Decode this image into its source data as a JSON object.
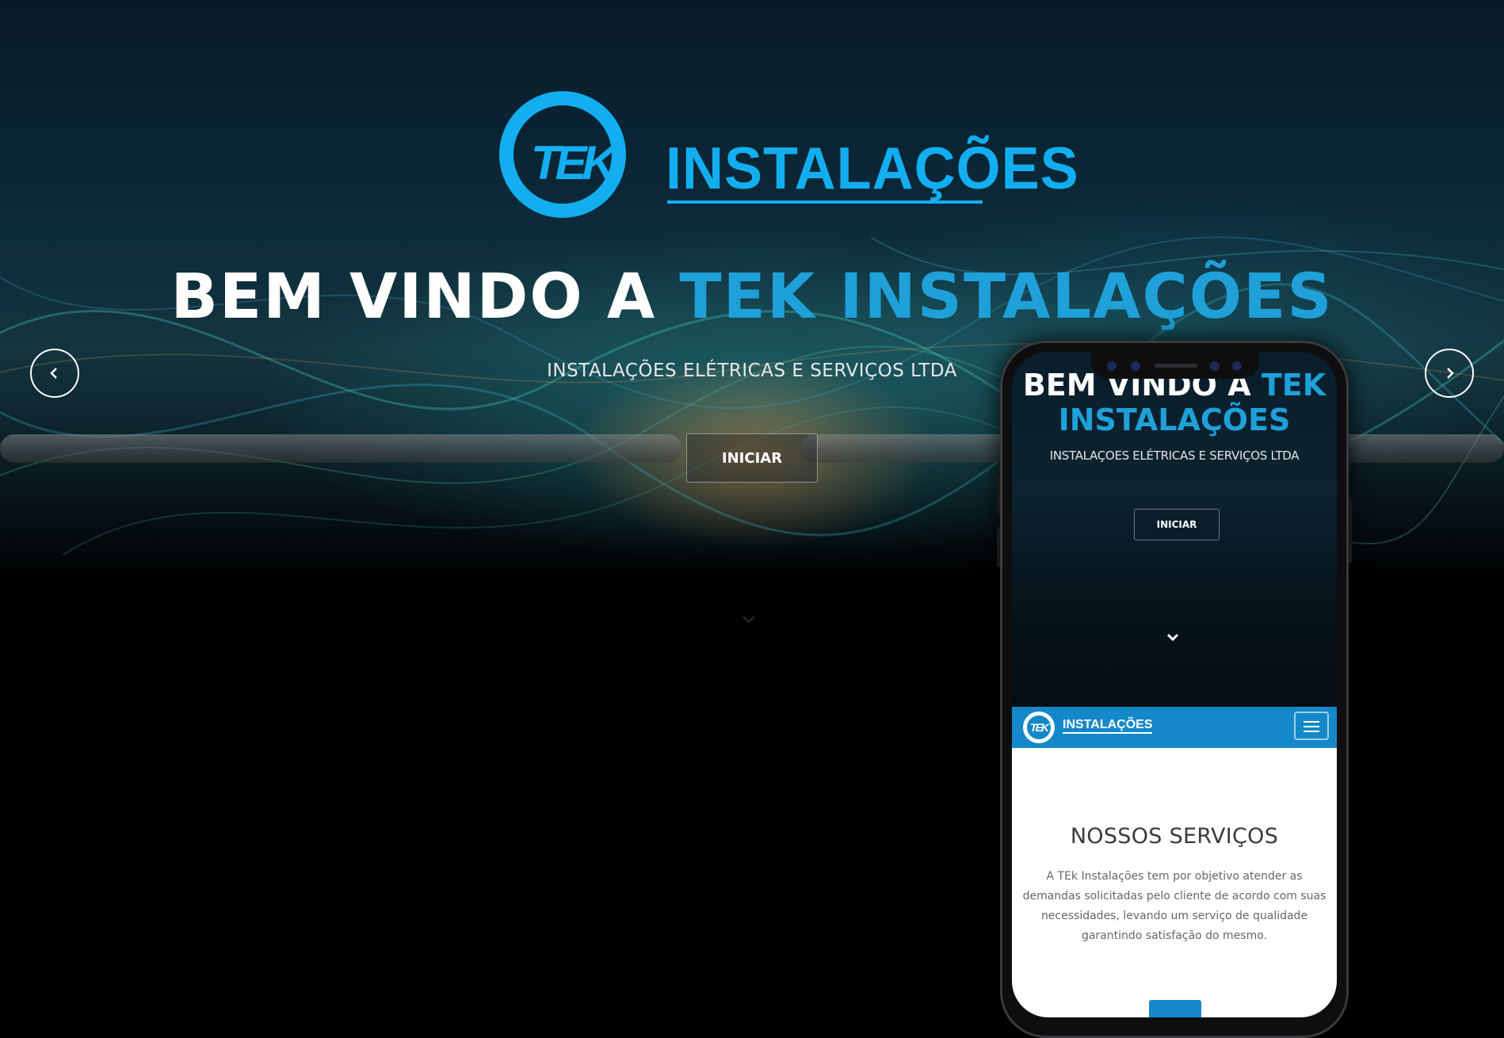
{
  "brand": {
    "logo_mark": "TEK",
    "logo_word": "INSTALAÇÕES",
    "accent_color": "#12aef0"
  },
  "hero": {
    "headline_prefix": "BEM VINDO A",
    "headline_accent": "TEK INSTALAÇÕES",
    "subtitle": "INSTALAÇÕES ELÉTRICAS E SERVIÇOS LTDA",
    "cta_label": "INICIAR",
    "prev_icon": "chevron-left-icon",
    "next_icon": "chevron-right-icon",
    "scroll_icon": "chevron-down-icon"
  },
  "phone": {
    "headline_prefix": "BEM VINDO A",
    "headline_accent": "TEK INSTALAÇÕES",
    "subtitle": "INSTALAÇOES ELÉTRICAS E SERVIÇOS LTDA",
    "cta_label": "INICIAR",
    "scroll_icon": "chevron-down-icon",
    "nav": {
      "logo_mark": "TEK",
      "logo_word": "INSTALAÇÕES",
      "menu_icon": "hamburger-menu-icon",
      "bar_color": "#1488c8"
    },
    "section_title": "NOSSOS SERVIÇOS",
    "section_text": "A TEk Instalações tem por objetivo atender as demandas solicitadas pelo cliente de acordo com suas necessidades, levando um serviço de qualidade garantindo satisfação do mesmo."
  }
}
